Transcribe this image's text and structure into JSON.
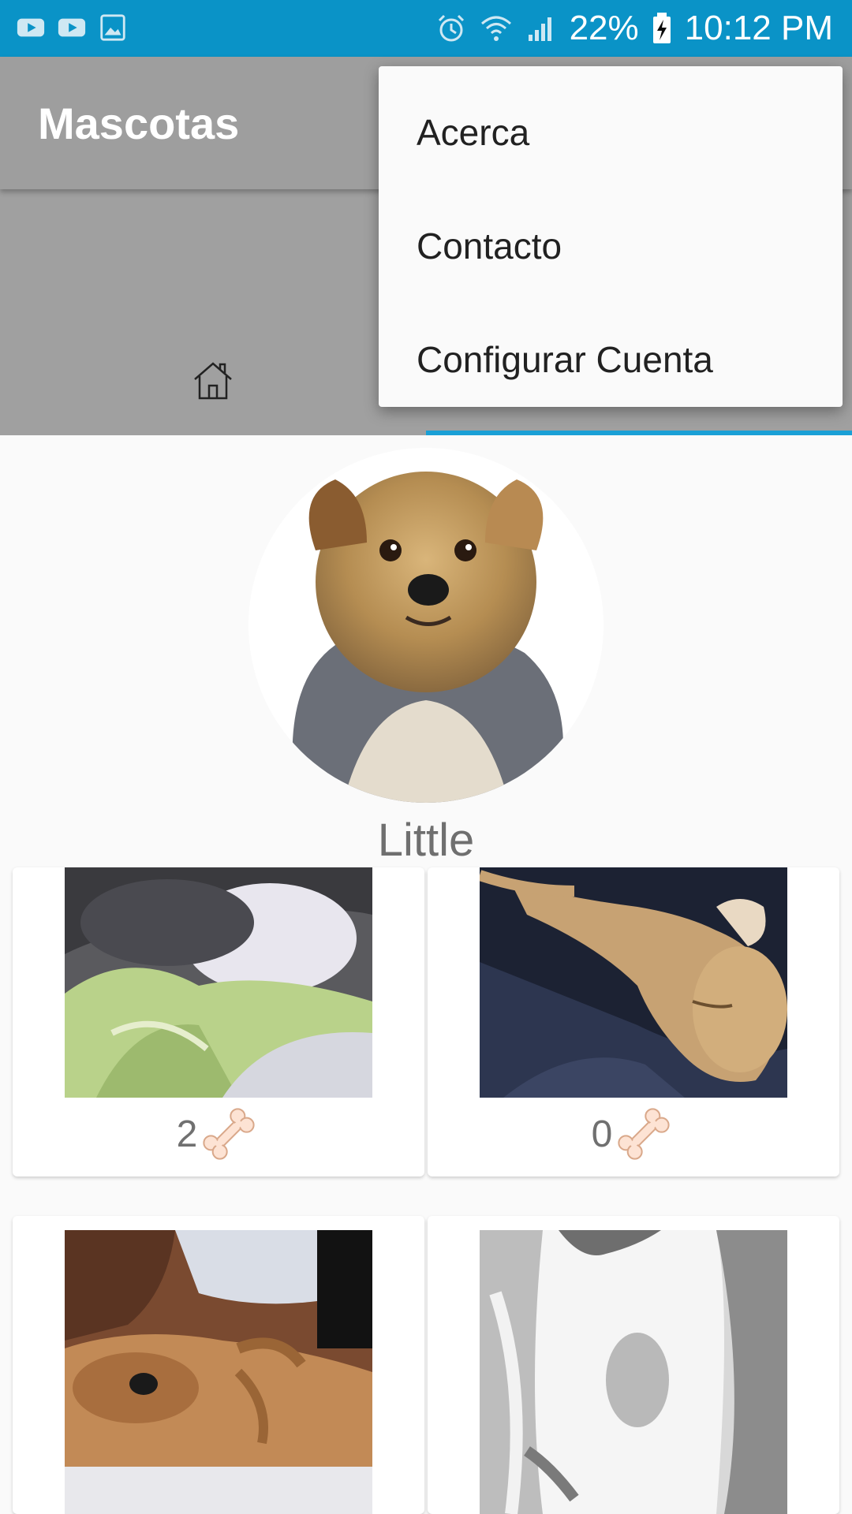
{
  "status_bar": {
    "battery_percent": "22%",
    "time": "10:12 PM",
    "icons": [
      "youtube-icon",
      "youtube-icon",
      "gallery-icon",
      "alarm-icon",
      "wifi-icon",
      "signal-icon",
      "battery-charging-icon"
    ]
  },
  "app_bar": {
    "title": "Mascotas"
  },
  "tabs": {
    "home_icon": "home-icon",
    "active_tab_index": 1
  },
  "menu": {
    "items": [
      {
        "label": "Acerca"
      },
      {
        "label": "Contacto"
      },
      {
        "label": "Configurar Cuenta"
      }
    ]
  },
  "profile": {
    "name": "Little"
  },
  "gallery": {
    "items": [
      {
        "likes": "2",
        "subject": "cat sleeping on blanket"
      },
      {
        "likes": "0",
        "subject": "dog sleeping on dark blanket"
      },
      {
        "subject": "dog lying on couch"
      },
      {
        "subject": "cat black and white"
      }
    ],
    "like_icon": "bone-icon"
  },
  "colors": {
    "status_bar": "#0a93c7",
    "app_bar_dimmed": "#9e9e9e",
    "tab_indicator": "#1aa0d6",
    "menu_bg": "#fafafa"
  }
}
